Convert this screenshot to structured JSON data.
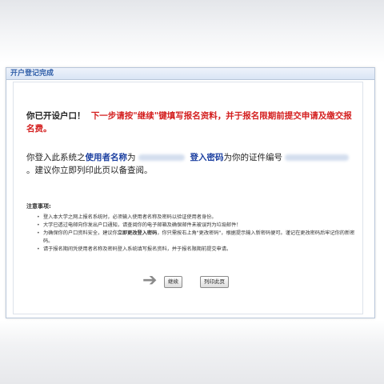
{
  "panel": {
    "title": "开户登记完成"
  },
  "message": {
    "line1_a": "你已开设户口！",
    "line1_b": "下一步请按\"继续\"键填写报名资料，并于报名限期前提交申请及缴交报名费。",
    "line2_a": "你登入此系统之",
    "username_label": "使用者名称",
    "line2_b": "为",
    "password_label": "登入密码",
    "line2_c": "为你的证件编号",
    "line2_d": "。建议你立即列印此页以备查阅。"
  },
  "notice": {
    "title": "注意事项:",
    "items": [
      {
        "text": "登入本大学之网上报名系统时，必须输入使用者名称及密码以验证使用者身份。"
      },
      {
        "text": "大学已透过电邮向你发出户口通知，请查阅你的电子邮箱及确保邮件未被误判为垃圾邮件！"
      },
      {
        "a": "为确保你的户口资料安全，建议你",
        "bold": "立即更改登入密码",
        "b": "，你只需按右上角\"更改密码\"，根据提示输入新密码便可。谨记在更改密码后牢记你的新密码。"
      },
      {
        "text": "请于报名期间凭使用者名称及密码登入系统填写报名资料，并于报名限期前提交申请。"
      }
    ]
  },
  "buttons": {
    "continue": "继续",
    "print": "列印此页"
  },
  "icons": {
    "arrow": "right-arrow-icon"
  }
}
